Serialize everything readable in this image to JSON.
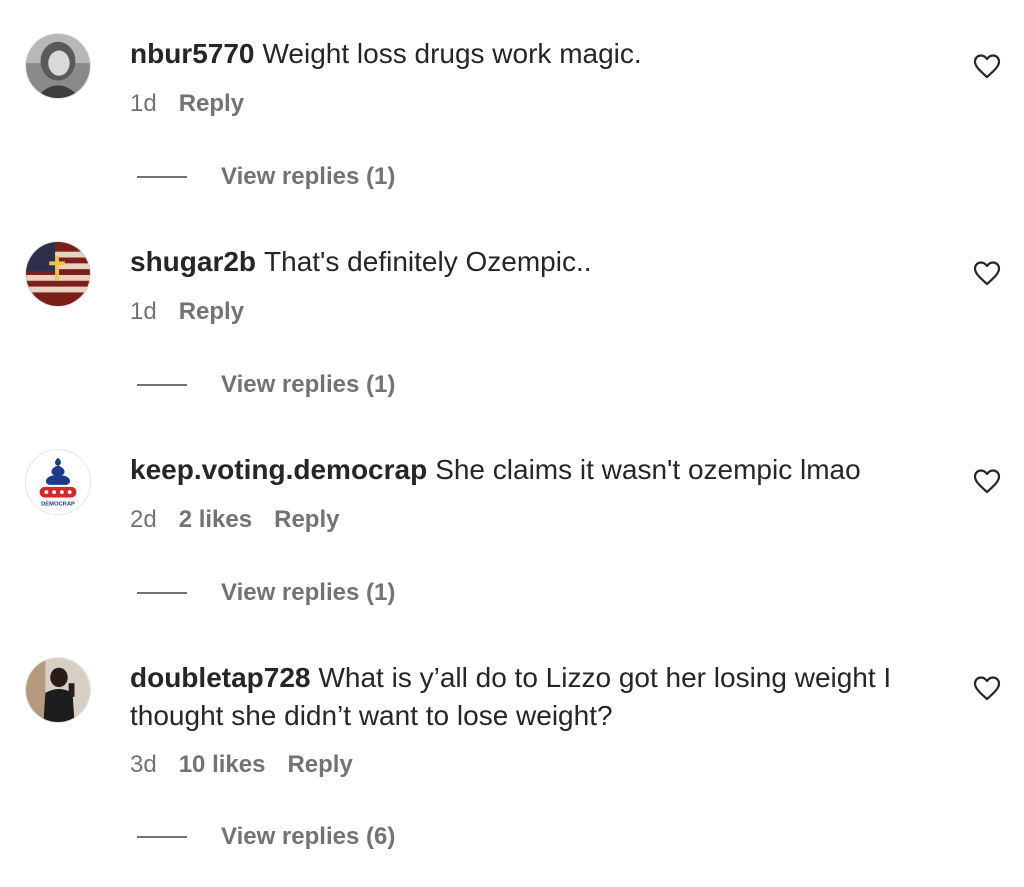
{
  "comments": [
    {
      "username": "nbur5770",
      "text": "Weight loss drugs work magic.",
      "time": "1d",
      "likes": "",
      "reply_label": "Reply",
      "view_replies_label": "View replies (1)"
    },
    {
      "username": "shugar2b",
      "text": "That's definitely Ozempic..",
      "time": "1d",
      "likes": "",
      "reply_label": "Reply",
      "view_replies_label": "View replies (1)"
    },
    {
      "username": "keep.voting.democrap",
      "text": "She claims it wasn't ozempic lmao",
      "time": "2d",
      "likes": "2 likes",
      "reply_label": "Reply",
      "view_replies_label": "View replies (1)",
      "avatar_text": "DEMOCRAP"
    },
    {
      "username": "doubletap728",
      "text": "What is y’all do to Lizzo got her losing weight I thought she didn’t want to lose weight?",
      "time": "3d",
      "likes": "10 likes",
      "reply_label": "Reply",
      "view_replies_label": "View replies (6)"
    }
  ],
  "icons": {
    "like": "heart-outline-icon"
  },
  "colors": {
    "text": "#262626",
    "secondary": "#737373",
    "background": "#ffffff"
  }
}
